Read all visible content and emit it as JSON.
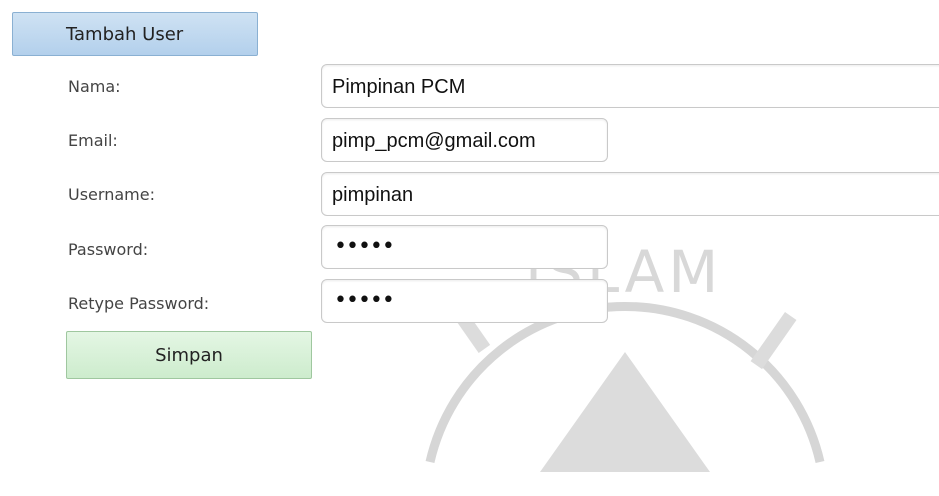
{
  "header": {
    "title": "Tambah User"
  },
  "form": {
    "nama": {
      "label": "Nama:",
      "value": "Pimpinan PCM"
    },
    "email": {
      "label": "Email:",
      "value": "pimp_pcm@gmail.com"
    },
    "username": {
      "label": "Username:",
      "value": "pimpinan"
    },
    "password": {
      "label": "Password:",
      "value": "•••••"
    },
    "retype_password": {
      "label": "Retype Password:",
      "value": "•••••"
    }
  },
  "actions": {
    "save_label": "Simpan"
  },
  "watermark": {
    "text": "ISLAM"
  },
  "colors": {
    "header_bg": "#b3d0ec",
    "save_bg": "#cdeccd",
    "watermark": "#d0d0d0"
  }
}
